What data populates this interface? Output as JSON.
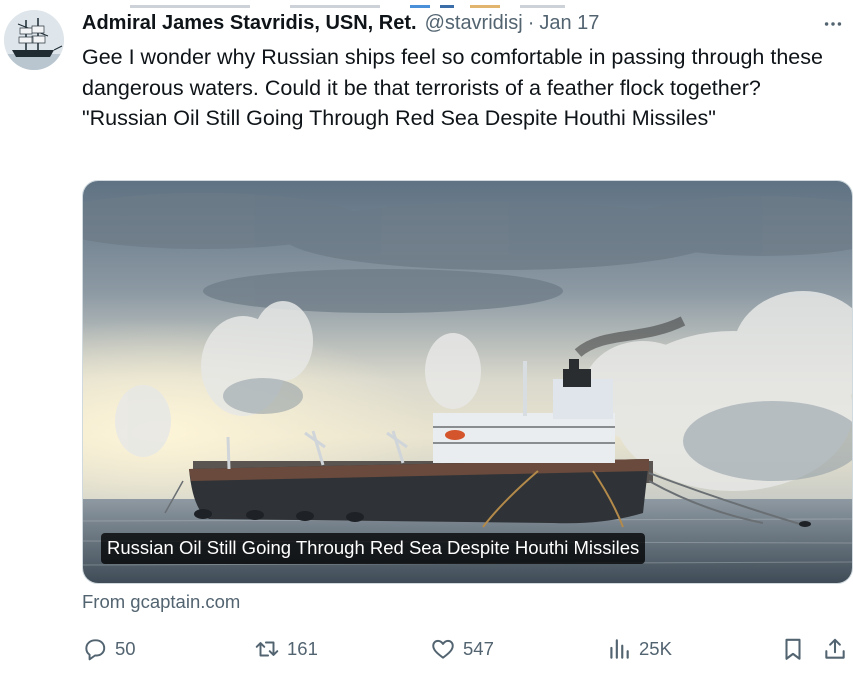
{
  "tweet": {
    "author": {
      "display_name": "Admiral James Stavridis, USN, Ret.",
      "handle": "@stavridisj",
      "separator": "·",
      "date": "Jan 17",
      "avatar_icon": "sailing-ship-avatar"
    },
    "text": "Gee I wonder why Russian ships feel so comfortable in passing through these dangerous waters. Could it be that terrorists of a feather flock together? \"Russian Oil Still Going Through Red Sea Despite Houthi Missiles\"",
    "card": {
      "image_icon": "oil-tanker-photo",
      "caption": "Russian Oil Still Going Through Red Sea Despite Houthi Missiles"
    },
    "source": "From gcaptain.com",
    "actions": {
      "replies": "50",
      "reposts": "161",
      "likes": "547",
      "views": "25K"
    }
  },
  "colors": {
    "text_primary": "#0f1419",
    "text_secondary": "#536471",
    "border": "#cfd9de",
    "caption_bg": "#000000"
  }
}
